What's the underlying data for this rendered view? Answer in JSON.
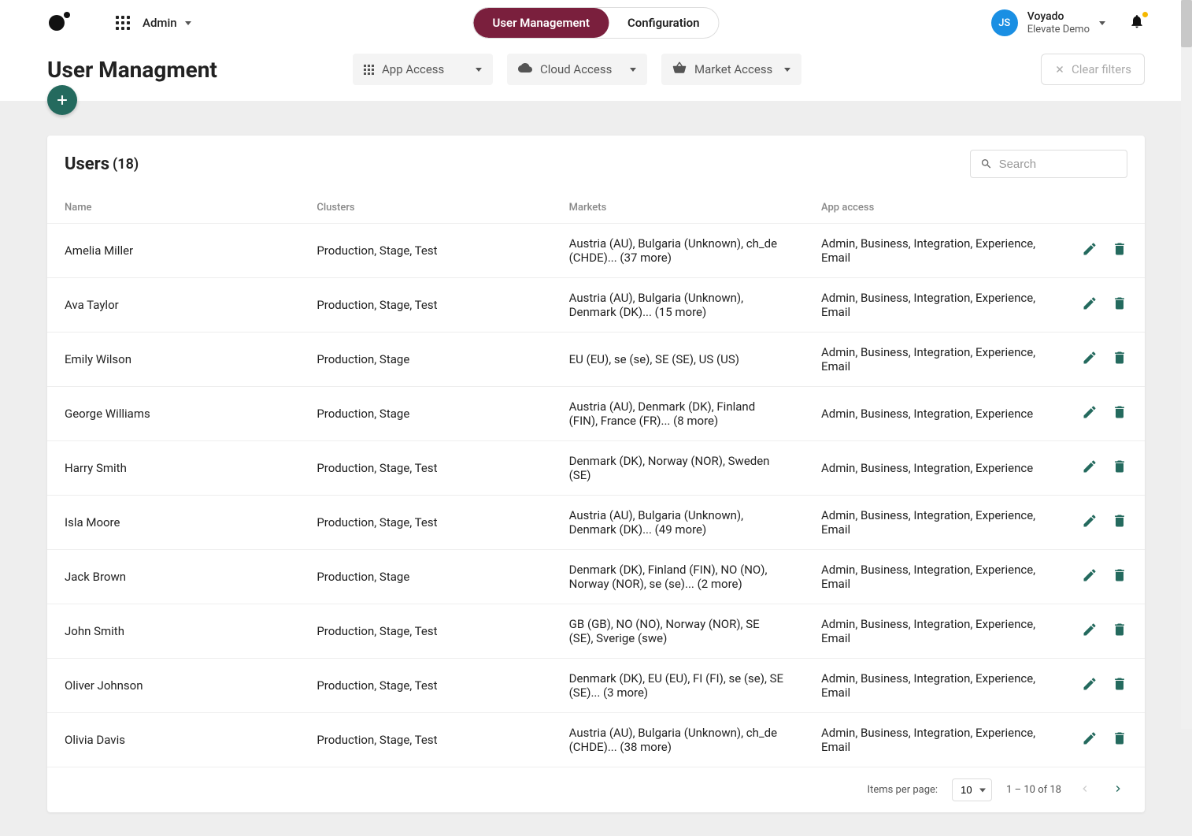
{
  "topbar": {
    "admin_label": "Admin",
    "tabs": [
      {
        "label": "User Management",
        "active": true
      },
      {
        "label": "Configuration",
        "active": false
      }
    ],
    "user": {
      "initials": "JS",
      "name": "Voyado",
      "sub": "Elevate Demo"
    }
  },
  "header": {
    "page_title": "User Managment",
    "filters": [
      {
        "icon": "apps",
        "label": "App Access"
      },
      {
        "icon": "cloud",
        "label": "Cloud Access"
      },
      {
        "icon": "basket",
        "label": "Market Access"
      }
    ],
    "clear_label": "Clear filters"
  },
  "card": {
    "title": "Users",
    "count": "(18)",
    "search_placeholder": "Search"
  },
  "columns": {
    "name": "Name",
    "clusters": "Clusters",
    "markets": "Markets",
    "access": "App access"
  },
  "users": [
    {
      "name": "Amelia Miller",
      "clusters": "Production, Stage, Test",
      "markets": "Austria (AU), Bulgaria (Unknown), ch_de (CHDE)... (37 more)",
      "access": "Admin, Business, Integration, Experience, Email"
    },
    {
      "name": "Ava Taylor",
      "clusters": "Production, Stage, Test",
      "markets": "Austria (AU), Bulgaria (Unknown), Denmark (DK)... (15 more)",
      "access": "Admin, Business, Integration, Experience, Email"
    },
    {
      "name": "Emily Wilson",
      "clusters": "Production, Stage",
      "markets": "EU (EU), se (se), SE (SE), US (US)",
      "access": "Admin, Business, Integration, Experience, Email"
    },
    {
      "name": "George Williams",
      "clusters": "Production, Stage",
      "markets": "Austria (AU), Denmark (DK), Finland (FIN), France (FR)... (8 more)",
      "access": "Admin, Business, Integration, Experience"
    },
    {
      "name": "Harry Smith",
      "clusters": "Production, Stage, Test",
      "markets": "Denmark (DK), Norway (NOR), Sweden (SE)",
      "access": "Admin, Business, Integration, Experience"
    },
    {
      "name": "Isla Moore",
      "clusters": "Production, Stage, Test",
      "markets": "Austria (AU), Bulgaria (Unknown), Denmark (DK)... (49 more)",
      "access": "Admin, Business, Integration, Experience, Email"
    },
    {
      "name": "Jack Brown",
      "clusters": "Production, Stage",
      "markets": "Denmark (DK), Finland (FIN), NO (NO), Norway (NOR), se (se)... (2 more)",
      "access": "Admin, Business, Integration, Experience, Email"
    },
    {
      "name": "John Smith",
      "clusters": "Production, Stage, Test",
      "markets": "GB (GB), NO (NO), Norway (NOR), SE (SE), Sverige (swe)",
      "access": "Admin, Business, Integration, Experience, Email"
    },
    {
      "name": "Oliver Johnson",
      "clusters": "Production, Stage, Test",
      "markets": "Denmark (DK), EU (EU), FI (FI), se (se), SE (SE)... (3 more)",
      "access": "Admin, Business, Integration, Experience, Email"
    },
    {
      "name": "Olivia Davis",
      "clusters": "Production, Stage, Test",
      "markets": "Austria (AU), Bulgaria (Unknown), ch_de (CHDE)... (38 more)",
      "access": "Admin, Business, Integration, Experience, Email"
    }
  ],
  "pager": {
    "items_label": "Items per page:",
    "per_page": "10",
    "range": "1 – 10 of 18"
  }
}
